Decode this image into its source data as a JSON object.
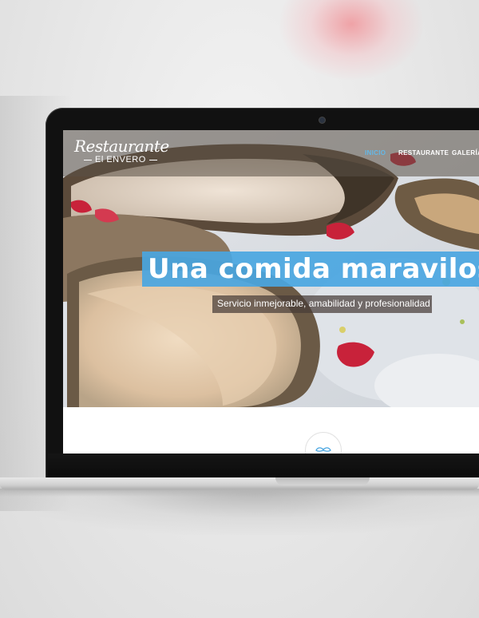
{
  "site": {
    "logo": {
      "script": "Restaurante",
      "name": "El ENVERO"
    },
    "nav": [
      {
        "label": "INICIO",
        "active": true
      },
      {
        "label": "RESTAURANTE",
        "active": false
      },
      {
        "label": "GALERÍA",
        "active": false
      }
    ],
    "hero": {
      "headline": "Una comida maravilosa",
      "tagline": "Servicio inmejorable, amabilidad y profesionalidad"
    },
    "section_icon": "mustache-icon"
  },
  "colors": {
    "accent": "#4aa6e1",
    "nav_active": "#63b8e8",
    "bezel": "#111111"
  }
}
